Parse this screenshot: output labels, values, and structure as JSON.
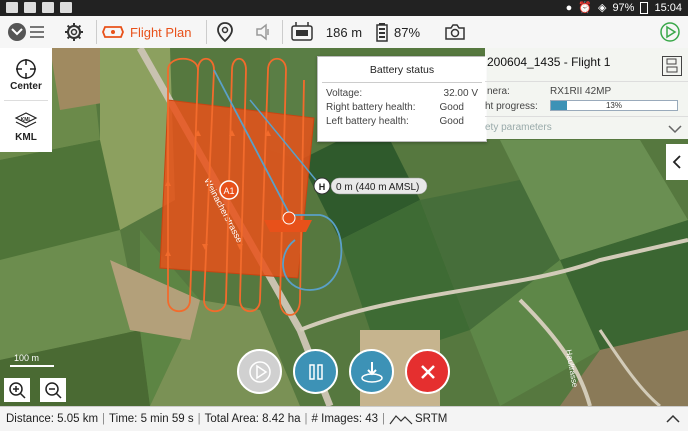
{
  "statusbar": {
    "battery": "97%",
    "time": "15:04"
  },
  "toolbar": {
    "flight_plan_label": "Flight Plan",
    "altitude": "186 m",
    "battery": "87%"
  },
  "left_panel": {
    "center_label": "Center",
    "kml_label": "KML",
    "kml_icon_text": "KML"
  },
  "battery_popup": {
    "title": "Battery status",
    "rows": [
      {
        "label": "Voltage:",
        "value": "32.00 V"
      },
      {
        "label": "Right battery health:",
        "value": "Good"
      },
      {
        "label": "Left battery health:",
        "value": "Good"
      }
    ]
  },
  "flight_panel": {
    "title": "200604_1435 - Flight 1",
    "camera_label": "nera:",
    "camera_value": "RX1RII 42MP",
    "progress_label": "ht progress:",
    "progress_value": 0.13,
    "progress_text": "13%",
    "safety_label": "ety parameters"
  },
  "map": {
    "home_label": "H",
    "home_text": "0 m (440 m AMSL)",
    "waypoint_label": "A1",
    "scale_text": "100 m",
    "road_label": "Weinacherstrasse",
    "road_label2": "Haultrasse"
  },
  "bottom": {
    "distance": "Distance:  5.05 km",
    "time": "Time:  5 min 59 s",
    "area": "Total Area:  8.42 ha",
    "images": "# Images:  43",
    "srtm": "SRTM"
  },
  "colors": {
    "accent": "#e8511a",
    "route": "#f26b2c",
    "flight_line": "#5aa0c8",
    "play": "#cccccc",
    "pause": "#3d92b6",
    "land": "#3d92b6",
    "abort": "#e52f2f"
  }
}
